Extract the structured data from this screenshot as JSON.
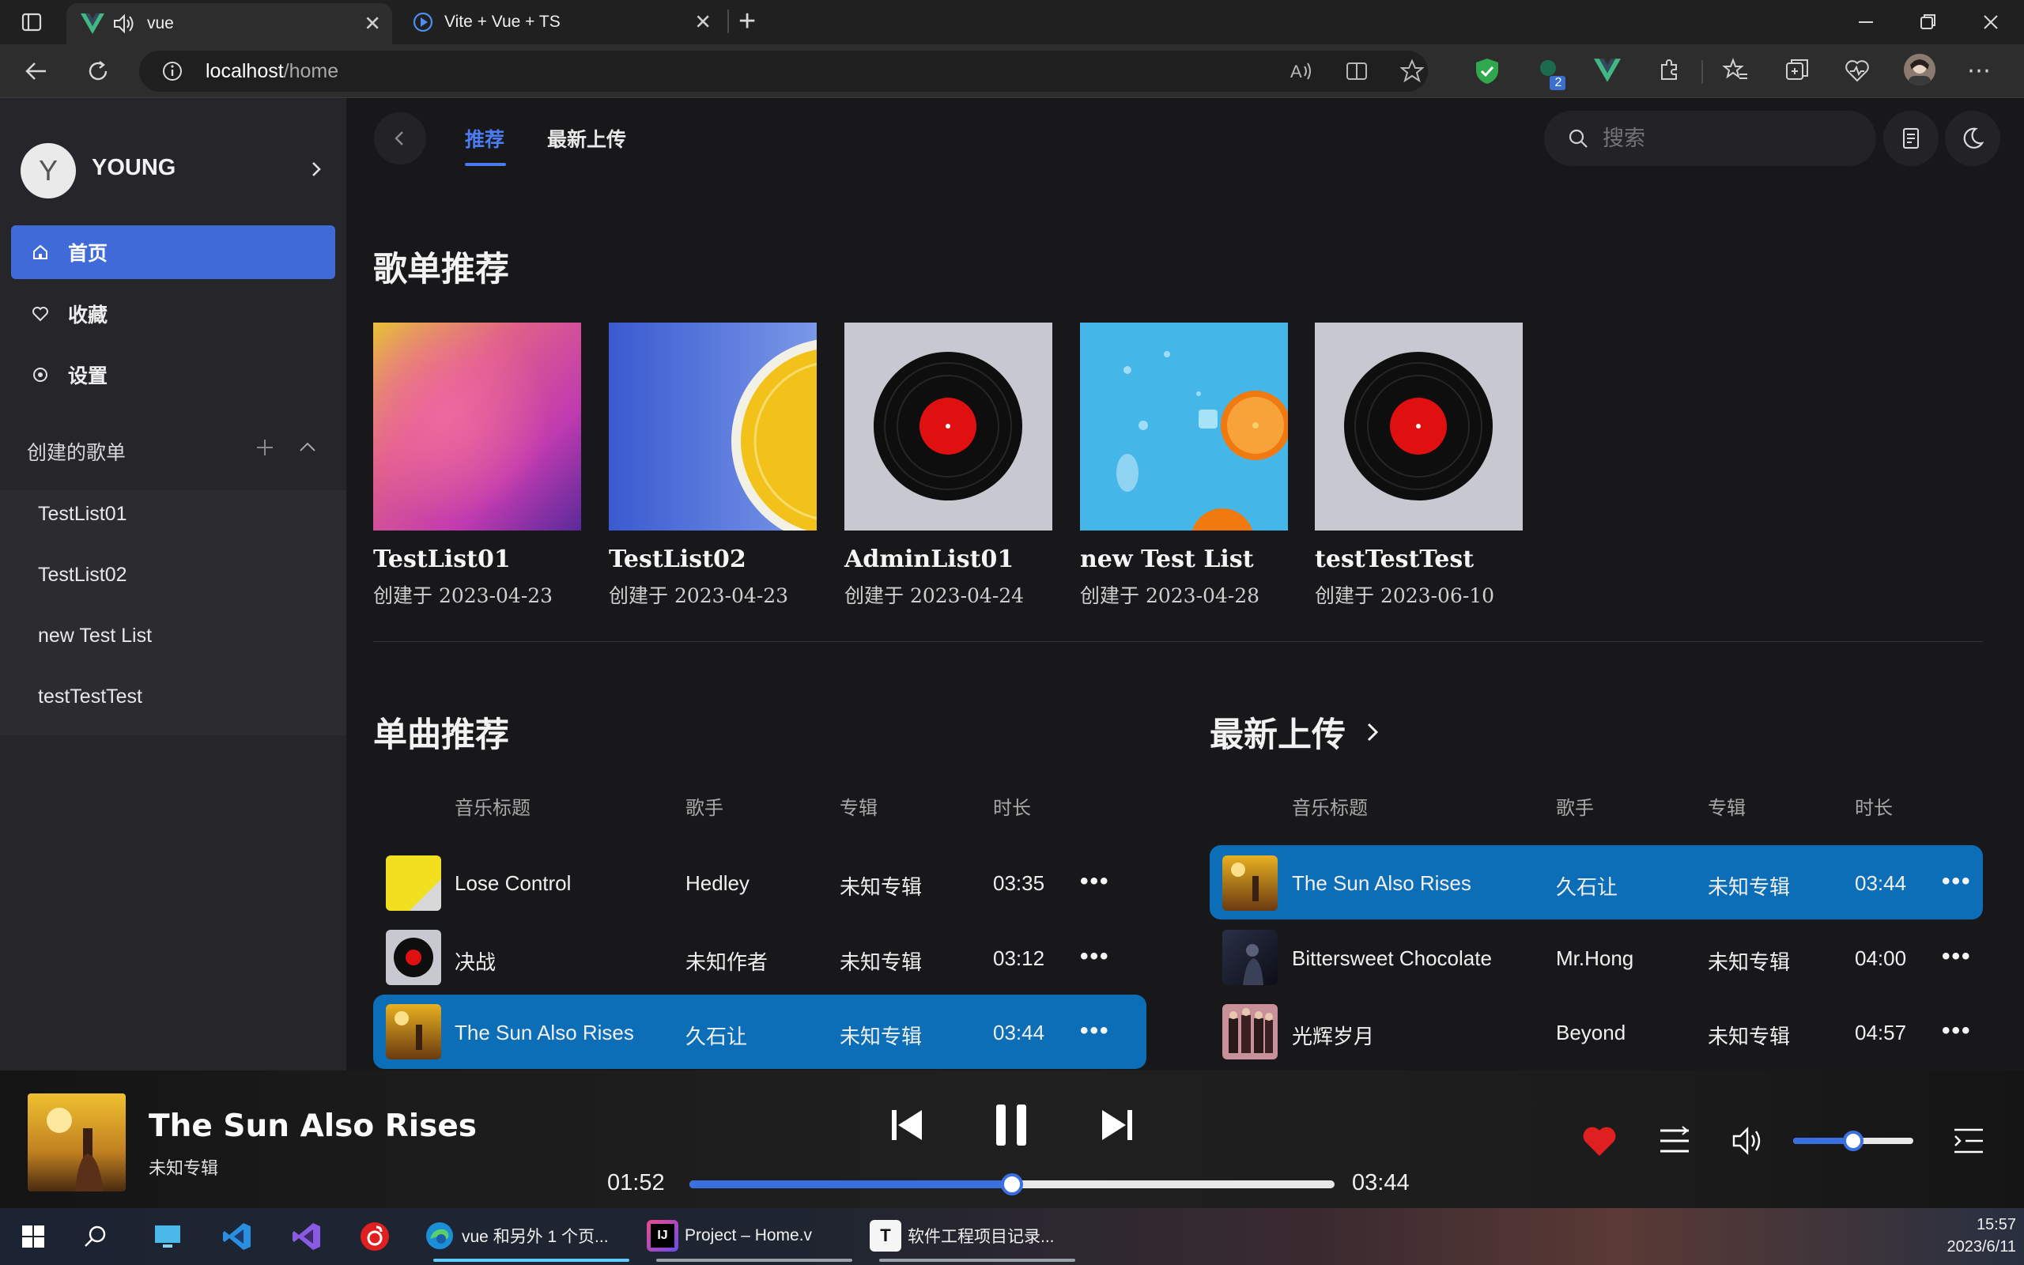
{
  "browser": {
    "tabs": [
      {
        "title": "vue",
        "active": true,
        "close": "✕"
      },
      {
        "title": "Vite + Vue + TS",
        "active": false,
        "close": "✕"
      }
    ],
    "new_tab": "+",
    "url_host": "localhost",
    "url_path": "/home",
    "profile_badge": "2",
    "window_controls": [
      "minimize-icon",
      "restore-icon",
      "close-icon"
    ]
  },
  "sidebar": {
    "avatar_letter": "Y",
    "username": "YOUNG",
    "nav": [
      {
        "label": "首页",
        "icon": "home-icon",
        "active": true
      },
      {
        "label": "收藏",
        "icon": "heart-icon",
        "active": false
      },
      {
        "label": "设置",
        "icon": "settings-icon",
        "active": false
      }
    ],
    "created_title": "创建的歌单",
    "playlists": [
      "TestList01",
      "TestList02",
      "new Test List",
      "testTestTest"
    ]
  },
  "header": {
    "tabs": [
      "推荐",
      "最新上传"
    ],
    "active_tab": "推荐",
    "search_placeholder": "搜索"
  },
  "playlist_section": {
    "title": "歌单推荐",
    "items": [
      {
        "name": "TestList01",
        "created": "创建于 2023-04-23",
        "cover": "purple-gradient"
      },
      {
        "name": "TestList02",
        "created": "创建于 2023-04-23",
        "cover": "lemon"
      },
      {
        "name": "AdminList01",
        "created": "创建于 2023-04-24",
        "cover": "vinyl"
      },
      {
        "name": "new Test List",
        "created": "创建于 2023-04-28",
        "cover": "orange-water"
      },
      {
        "name": "testTestTest",
        "created": "创建于 2023-06-10",
        "cover": "vinyl"
      }
    ]
  },
  "songs_section": {
    "title": "单曲推荐",
    "columns": [
      "音乐标题",
      "歌手",
      "专辑",
      "时长"
    ],
    "rows": [
      {
        "title": "Lose Control",
        "artist": "Hedley",
        "album": "未知专辑",
        "duration": "03:35",
        "thumb": "yellow",
        "highlight": false
      },
      {
        "title": "决战",
        "artist": "未知作者",
        "album": "未知专辑",
        "duration": "03:12",
        "thumb": "vinyl",
        "highlight": false
      },
      {
        "title": "The Sun Also Rises",
        "artist": "久石让",
        "album": "未知专辑",
        "duration": "03:44",
        "thumb": "sun",
        "highlight": true
      }
    ],
    "more": "•••"
  },
  "latest_section": {
    "title": "最新上传",
    "columns": [
      "音乐标题",
      "歌手",
      "专辑",
      "时长"
    ],
    "rows": [
      {
        "title": "The Sun Also Rises",
        "artist": "久石让",
        "album": "未知专辑",
        "duration": "03:44",
        "thumb": "sun",
        "highlight": true
      },
      {
        "title": "Bittersweet Chocolate",
        "artist": "Mr.Hong",
        "album": "未知专辑",
        "duration": "04:00",
        "thumb": "dark",
        "highlight": false
      },
      {
        "title": "光辉岁月",
        "artist": "Beyond",
        "album": "未知专辑",
        "duration": "04:57",
        "thumb": "band",
        "highlight": false
      }
    ],
    "more": "•••"
  },
  "player": {
    "title": "The Sun Also Rises",
    "album": "未知专辑",
    "current_time": "01:52",
    "total_time": "03:44",
    "progress": 0.5,
    "volume": 0.5,
    "liked": true,
    "colors": {
      "accent": "#3a6fe0",
      "like": "#e02020",
      "highlight_row": "#0d6eb8"
    }
  },
  "taskbar": {
    "apps": [
      {
        "label": "vue 和另外 1 个页..."
      },
      {
        "label": "Project – Home.v"
      },
      {
        "label": "软件工程项目记录..."
      }
    ],
    "time": "15:57",
    "date": "2023/6/11"
  }
}
